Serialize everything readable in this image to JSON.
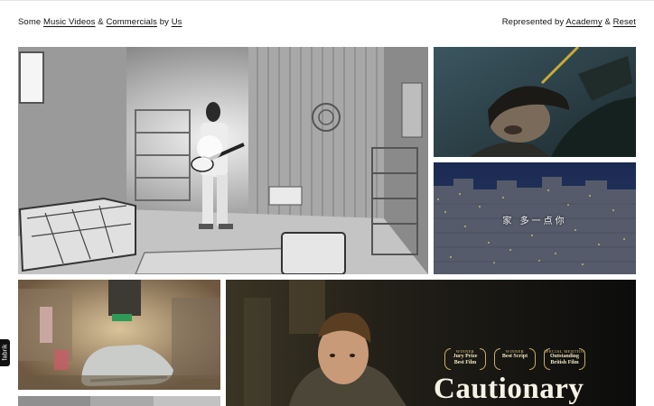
{
  "header": {
    "left_prefix": "Some",
    "music_videos_link": "Music Videos",
    "ampersand": "&",
    "commercials_link": "Commercials",
    "by_text": "by",
    "us_link": "Us",
    "represented_by": "Represented by",
    "academy_link": "Academy",
    "ampersand2": "&",
    "reset_link": "Reset"
  },
  "tiles": {
    "main": {
      "label": "guitarist-white-room-still"
    },
    "portrait": {
      "label": "man-looking-up-still"
    },
    "city": {
      "label": "city-night-still",
      "caption": "家 多一点你"
    },
    "shoe": {
      "label": "sneaker-room-still"
    },
    "strip": {
      "label": "next-row-still"
    },
    "cautionary": {
      "label": "cautionary-film-still",
      "title": "Cautionary",
      "laurels": [
        {
          "top": "WINNER",
          "line1": "Jury Prize",
          "line2": "Best Film"
        },
        {
          "top": "WINNER",
          "line1": "Best Script",
          "line2": ""
        },
        {
          "top": "SPECIAL MENTION",
          "line1": "Outstanding",
          "line2": "British Film"
        }
      ]
    }
  },
  "side_tab": {
    "label": "fabrik"
  },
  "colors": {
    "background": "#ffffff",
    "text": "#111111",
    "laurel_gold": "#d8c27a",
    "side_tab": "#111111"
  }
}
